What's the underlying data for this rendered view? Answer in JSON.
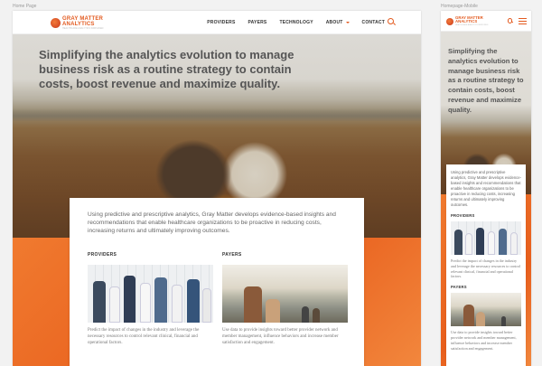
{
  "artboards": {
    "desktop_label": "Home Page",
    "mobile_label": "Homepage-Mobile"
  },
  "brand": {
    "line1": "GRAY MATTER",
    "line2": "ANALYTICS",
    "tagline": "HEALTHCARE ANALYTICS SIMPLIFIED",
    "color": "#e35a1f"
  },
  "nav": {
    "items": [
      "PROVIDERS",
      "PAYERS",
      "TECHNOLOGY",
      "ABOUT",
      "CONTACT"
    ]
  },
  "icons": {
    "search": "search-icon",
    "menu": "hamburger-menu-icon",
    "dropdown": "chevron-down-icon"
  },
  "hero": {
    "headline": "Simplifying the analytics evolution to manage business risk as a routine strategy to contain costs, boost revenue and maximize quality."
  },
  "intro": {
    "text": "Using predictive and prescriptive analytics, Gray Matter develops evidence-based insights and recommendations that enable healthcare organizations to be proactive in reducing costs, increasing returns and ultimately improving outcomes."
  },
  "sections": {
    "providers": {
      "title": "PROVIDERS",
      "text": "Predict the impact of changes in the industry and leverage the necessary resources to control relevant clinical, financial and operational factors."
    },
    "payers": {
      "title": "PAYERS",
      "text": "Use data to provide insights toward better provider network and member management, influence behaviors and increase member satisfaction and engagement."
    }
  },
  "colors": {
    "accent": "#e35a1f",
    "orange_band": "#e85e1c",
    "text": "#555555"
  }
}
